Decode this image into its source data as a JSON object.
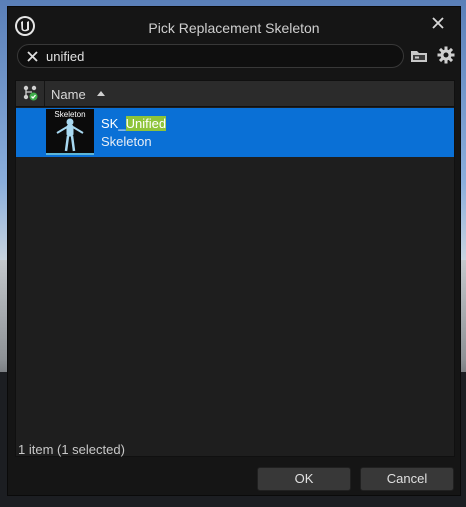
{
  "dialog": {
    "title": "Pick Replacement Skeleton",
    "close_icon": "close-icon",
    "logo_icon": "unreal-logo-icon"
  },
  "search": {
    "value": "unified",
    "clear_icon": "clear-search-icon",
    "folder_icon": "folder-icon",
    "settings_icon": "gear-icon"
  },
  "list": {
    "header": {
      "filter_icon": "hierarchy-filter-icon",
      "name_label": "Name",
      "sort": "ascending"
    },
    "items": [
      {
        "thumbnail_label": "Skeleton",
        "name_prefix": "SK_",
        "name_match": "Unified",
        "type": "Skeleton",
        "selected": true
      }
    ],
    "status": "1 item (1 selected)"
  },
  "buttons": {
    "ok": "OK",
    "cancel": "Cancel"
  },
  "colors": {
    "selection": "#0a70d6",
    "highlight": "#8ec43a",
    "dialog_bg": "#151515"
  }
}
